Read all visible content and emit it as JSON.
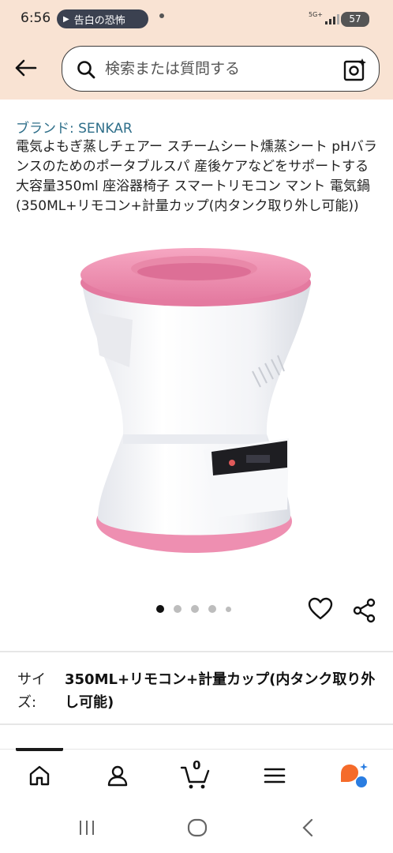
{
  "status_bar": {
    "time": "6:56",
    "media_title": "告白の恐怖",
    "network": "5G+",
    "battery": "57"
  },
  "search": {
    "placeholder": "検索または質問する"
  },
  "product": {
    "brand": "ブランド: SENKAR",
    "title": "電気よもぎ蒸しチェアー スチームシート燻蒸シート pHバランスのためのポータブルスパ 産後ケアなどをサポートする 大容量350ml 座浴器椅子 スマートリモコン マント 電気鍋 (350ML+リモコン+計量カップ(内タンク取り外し可能))",
    "image_count": 5,
    "active_image": 1,
    "colors": {
      "pink": "#ef8fb0",
      "body": "#f2f3f6",
      "brand_link": "#2f6f8a"
    }
  },
  "size": {
    "label": "サイズ:",
    "value": "350ML+リモコン+計量カップ(内タンク取り外し可能)"
  },
  "bottom_nav": {
    "items": [
      "home-icon",
      "account-icon",
      "cart-icon",
      "menu-icon",
      "assistant-icon"
    ],
    "cart_count": "0"
  },
  "theme": {
    "header_bg": "#f9e3d3",
    "assistant_orange": "#f56b2a",
    "assistant_blue": "#2a7de1"
  }
}
